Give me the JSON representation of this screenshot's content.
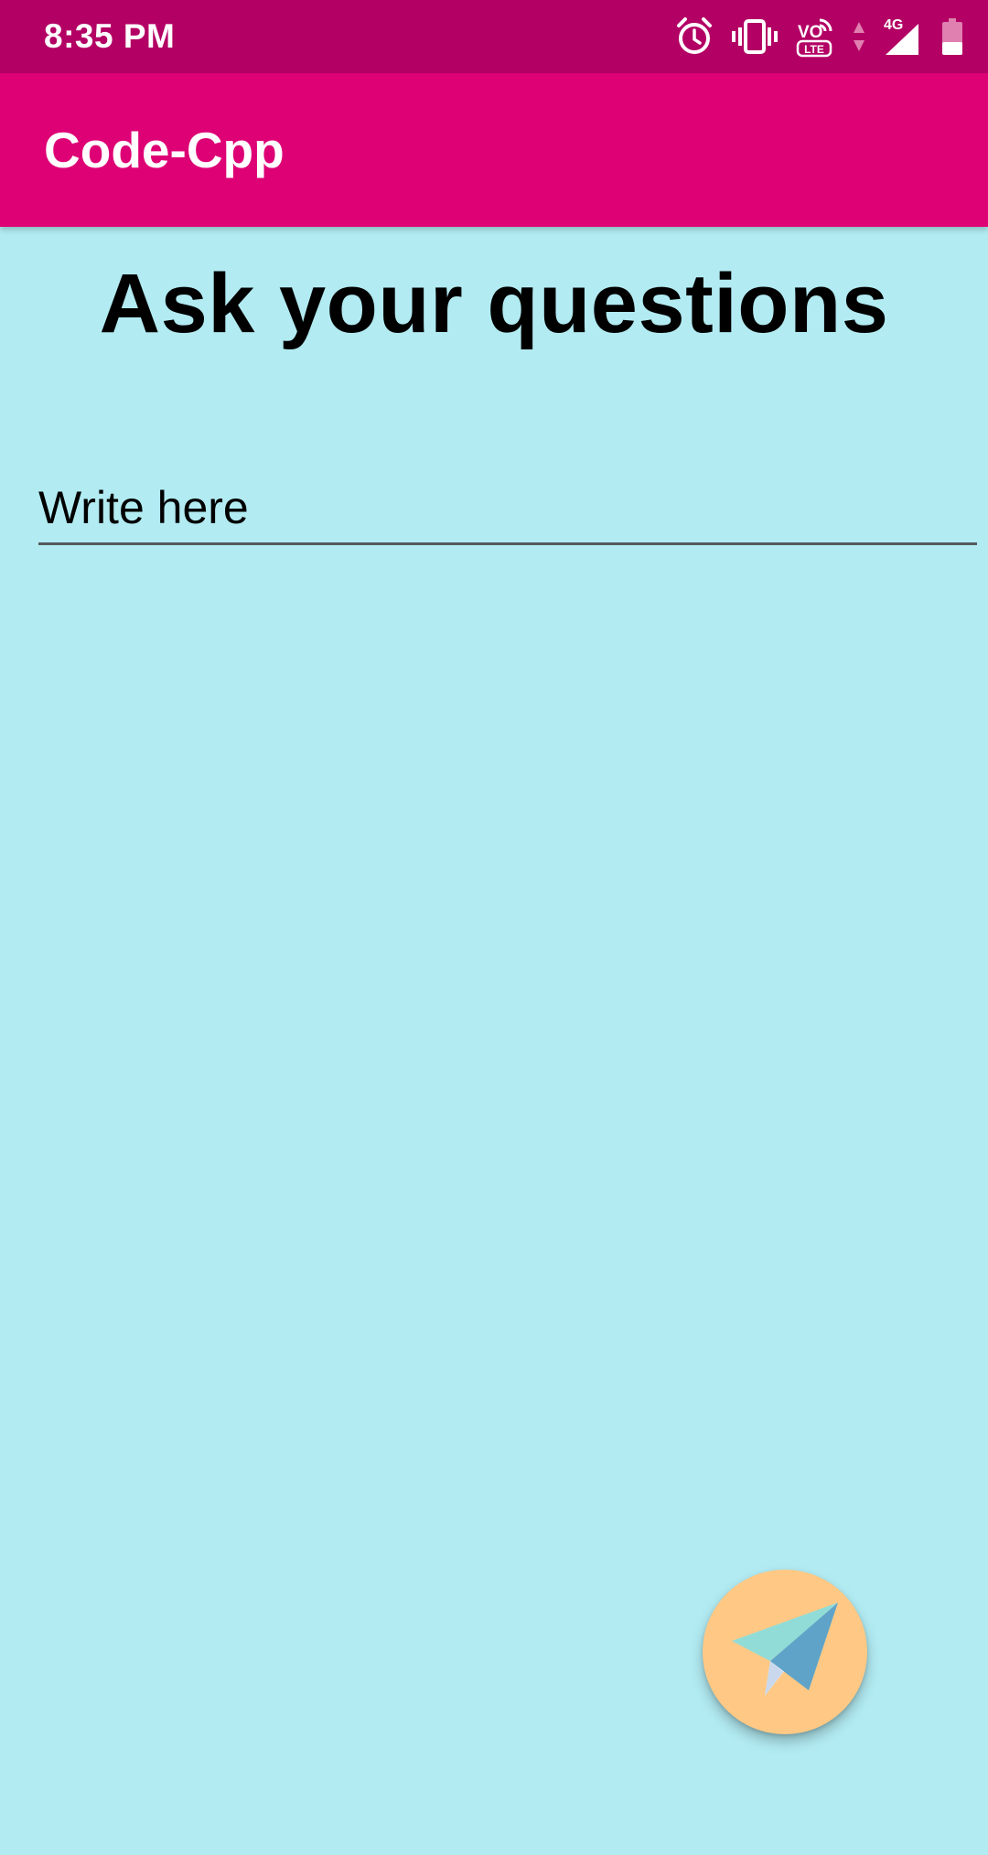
{
  "status_bar": {
    "time": "8:35 PM",
    "network": "4G",
    "volte": "VO",
    "lte": "LTE",
    "icons": [
      "alarm-icon",
      "vibrate-icon",
      "volte-icon",
      "data-arrows-icon",
      "signal-icon",
      "battery-icon"
    ],
    "background_color": "#b30064"
  },
  "app_bar": {
    "title": "Code-Cpp",
    "background_color": "#de0075"
  },
  "main": {
    "heading": "Ask your questions",
    "question_input": {
      "placeholder": "Write here",
      "value": ""
    },
    "background_color": "#b2ebf2"
  },
  "fab": {
    "icon": "paper-plane-icon",
    "background_color": "#ffc985"
  }
}
